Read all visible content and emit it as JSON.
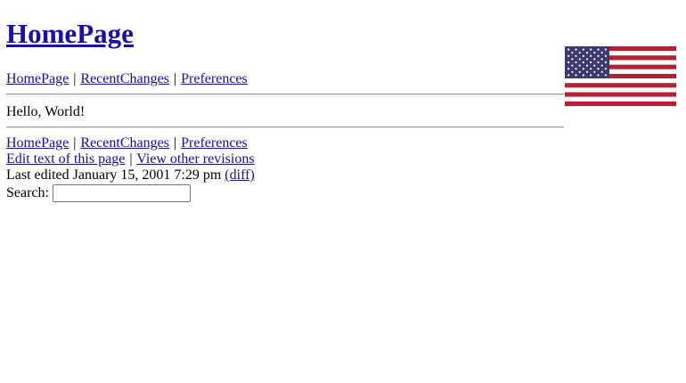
{
  "page": {
    "title": "HomePage"
  },
  "nav": {
    "items": [
      {
        "label": "HomePage"
      },
      {
        "label": "RecentChanges"
      },
      {
        "label": "Preferences"
      }
    ],
    "separator": "|"
  },
  "content": {
    "text": "Hello, World!"
  },
  "footer": {
    "edit_link": "Edit text of this page",
    "revisions_link": "View other revisions",
    "last_edited_prefix": "Last edited January 15, 2001 7:29 pm",
    "diff_link": "(diff)",
    "search_label": "Search:",
    "search_value": ""
  },
  "flag": {
    "icon": "us-flag-icon",
    "stripe_red": "#b22234",
    "canton_blue": "#3c3b6e"
  }
}
